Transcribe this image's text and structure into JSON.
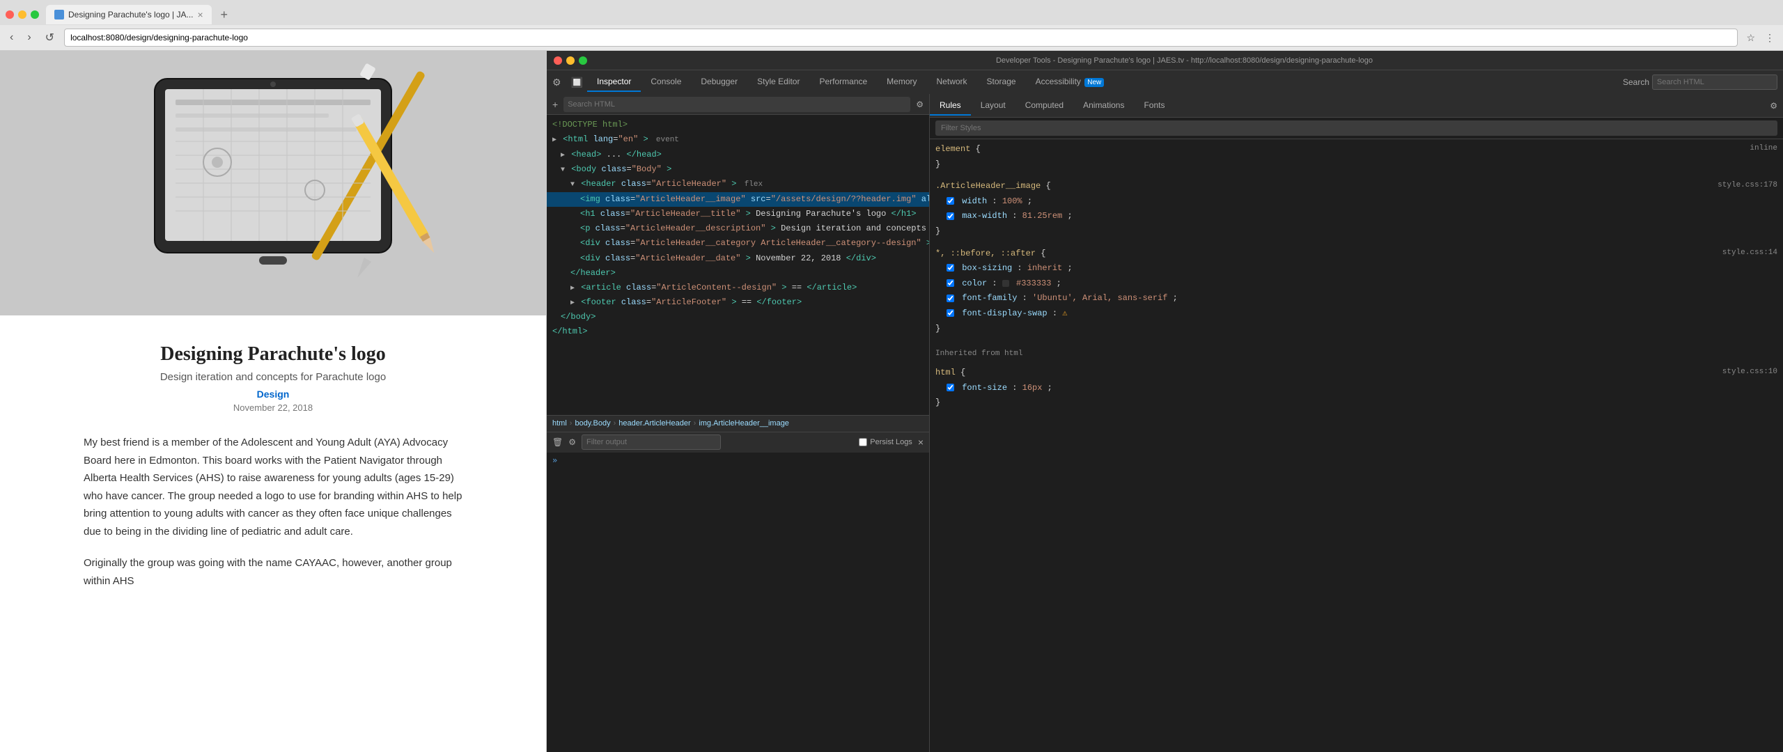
{
  "browser": {
    "tab_title": "Designing Parachute's logo | JA...",
    "tab_close": "×",
    "tab_new": "+",
    "url": "localhost:8080/design/designing-parachute-logo",
    "nav_back": "‹",
    "nav_forward": "›",
    "nav_refresh": "↺"
  },
  "article": {
    "title": "Designing Parachute's logo",
    "description": "Design iteration and concepts for Parachute logo",
    "category": "Design",
    "date": "November 22, 2018",
    "para1": "My best friend is a member of the Adolescent and Young Adult (AYA) Advocacy Board here in Edmonton. This board works with the Patient Navigator through Alberta Health Services (AHS) to raise awareness for young adults (ages 15-29) who have cancer. The group needed a logo to use for branding within AHS to help bring attention to young adults with cancer as they often face unique challenges due to being in the dividing line of pediatric and adult care.",
    "para2": "Originally the group was going with the name CAYAAC, however, another group within AHS"
  },
  "devtools": {
    "window_title": "Developer Tools - Designing Parachute's logo | JAES.tv - http://localhost:8080/design/designing-parachute-logo",
    "traffic_red": "●",
    "traffic_yellow": "●",
    "traffic_green": "●",
    "tabs": [
      {
        "label": "Inspector",
        "active": true
      },
      {
        "label": "Console",
        "active": false
      },
      {
        "label": "Debugger",
        "active": false
      },
      {
        "label": "Style Editor",
        "active": false
      },
      {
        "label": "Performance",
        "active": false
      },
      {
        "label": "Memory",
        "active": false
      },
      {
        "label": "Network",
        "active": false
      },
      {
        "label": "Storage",
        "active": false
      },
      {
        "label": "Accessibility",
        "active": false,
        "badge": "New"
      }
    ],
    "search_placeholder": "Search HTML"
  },
  "html_panel": {
    "lines": [
      {
        "text": "<!DOCTYPE html>",
        "indent": 0,
        "type": "doctype"
      },
      {
        "text": "<html lang=\"en\"> event",
        "indent": 0,
        "type": "tag"
      },
      {
        "text": "▶ <head>...</head>",
        "indent": 1,
        "type": "collapsed"
      },
      {
        "text": "▼ <body class=\"Body\">",
        "indent": 1,
        "type": "tag"
      },
      {
        "text": "▼ <header class=\"ArticleHeader\"> flex",
        "indent": 2,
        "type": "tag"
      },
      {
        "text": "<img class=\"ArticleHeader__image\" src=\"/assets/design/??header.img\" alt=\"Article Image\">",
        "indent": 3,
        "type": "selected"
      },
      {
        "text": "<h1 class=\"ArticleHeader__title\">Designing Parachute's logo</h1>",
        "indent": 3,
        "type": "tag"
      },
      {
        "text": "<p class=\"ArticleHeader__description\">Design iteration and concepts for Parachute logo</p>",
        "indent": 3,
        "type": "tag"
      },
      {
        "text": "<div class=\"ArticleHeader__category ArticleHeader__category--design\">Design</div>",
        "indent": 3,
        "type": "tag"
      },
      {
        "text": "<div class=\"ArticleHeader__date\">November 22, 2018</div>",
        "indent": 3,
        "type": "tag"
      },
      {
        "text": "</header>",
        "indent": 2,
        "type": "close"
      },
      {
        "text": "▶ <article class=\"ArticleContent--design\"> == </article>",
        "indent": 2,
        "type": "collapsed"
      },
      {
        "text": "▶ <footer class=\"ArticleFooter\"> == </footer>",
        "indent": 2,
        "type": "collapsed"
      },
      {
        "text": "</body>",
        "indent": 1,
        "type": "close"
      },
      {
        "text": "</html>",
        "indent": 0,
        "type": "close"
      }
    ]
  },
  "breadcrumb": {
    "items": [
      "html",
      "body.Body",
      "header.ArticleHeader",
      "img.ArticleHeader__image"
    ]
  },
  "css_panel": {
    "tabs": [
      "Rules",
      "Layout",
      "Computed",
      "Animations",
      "Fonts"
    ],
    "active_tab": "Rules",
    "filter_placeholder": "Filter Styles",
    "rules": [
      {
        "selector": "element",
        "open_brace": "{",
        "close_brace": "}",
        "source": "inline",
        "properties": []
      },
      {
        "selector": ".ArticleHeader__image",
        "open_brace": "{",
        "close_brace": "}",
        "source": "style.css:178",
        "properties": [
          {
            "name": "width",
            "value": "100%",
            "checked": true
          },
          {
            "name": "max-width",
            "value": "81.25rem",
            "checked": true
          }
        ]
      },
      {
        "selector": "*, ::before, ::after",
        "open_brace": "{",
        "close_brace": "}",
        "source": "style.css:14",
        "properties": [
          {
            "name": "box-sizing",
            "value": "inherit",
            "checked": true
          },
          {
            "name": "color",
            "value": "#333333",
            "checked": true,
            "has_color": true
          },
          {
            "name": "font-family",
            "value": "'Ubuntu', Arial, sans-serif",
            "checked": true
          },
          {
            "name": "font-display-swap",
            "value": "",
            "checked": true,
            "has_warning": true
          }
        ]
      }
    ],
    "inherited_header": "Inherited from html",
    "inherited_rules": [
      {
        "selector": "html",
        "open_brace": "{",
        "close_brace": "}",
        "source": "style.css:10",
        "properties": [
          {
            "name": "font-size",
            "value": "16px",
            "checked": true
          }
        ]
      }
    ]
  },
  "console": {
    "filter_placeholder": "Filter output",
    "persist_logs_label": "Persist Logs",
    "close_btn": "×",
    "prompt_symbol": "»",
    "clear_icon": "🗑",
    "filter_icon": "⚙"
  }
}
